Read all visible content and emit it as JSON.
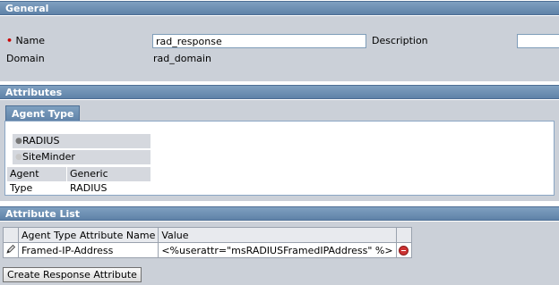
{
  "general": {
    "header": "General",
    "name_required_mark": "•",
    "name_label": "Name",
    "name_value": "rad_response",
    "description_label": "Description",
    "description_value": "",
    "domain_label": "Domain",
    "domain_value": "rad_domain"
  },
  "attributes": {
    "header": "Attributes",
    "tab_label": "Agent Type",
    "radio_options": [
      {
        "label": "RADIUS",
        "selected": true
      },
      {
        "label": "SiteMinder",
        "selected": false
      }
    ],
    "agent_type_label": "Agent Type",
    "agent_type_value": "Generic RADIUS"
  },
  "attribute_list": {
    "header": "Attribute List",
    "columns": [
      "Agent Type Attribute Name",
      "Value"
    ],
    "rows": [
      {
        "name": "Framed-IP-Address",
        "value": "<%userattr=\"msRADIUSFramedIPAddress\" %>"
      }
    ],
    "create_button": "Create Response Attribute"
  },
  "icons": {
    "edit": "pencil-icon",
    "remove": "minus-circle-icon"
  },
  "colors": {
    "header_bg": "#5f82a8",
    "panel_bg": "#cbd0d8",
    "required": "#cc0000"
  }
}
